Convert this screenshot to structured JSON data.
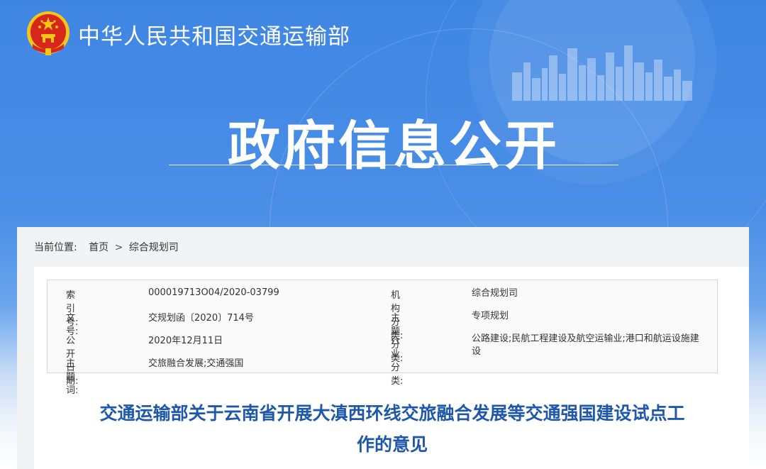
{
  "header": {
    "ministry_name": "中华人民共和国交通运输部",
    "banner_title": "政府信息公开",
    "emblem_icon": "national-emblem-icon"
  },
  "breadcrumb": {
    "label": "当前位置:",
    "home": "首页",
    "separator": ">",
    "current": "综合规划司"
  },
  "metadata": {
    "left": [
      {
        "label": "索引号:",
        "value": "000019713O04/2020-03799"
      },
      {
        "label": "文号:",
        "value": "交规划函〔2020〕714号"
      },
      {
        "label": "公开日期:",
        "value": "2020年12月11日"
      },
      {
        "label": "主题词:",
        "value": "交旅融合发展;交通强国"
      }
    ],
    "right": [
      {
        "label": "机构分类:",
        "value": "综合规划司"
      },
      {
        "label": "主题分类:",
        "value": "专项规划"
      },
      {
        "label": "行业分类:",
        "value": "公路建设;民航工程建设及航空运输业;港口和航运设施建设"
      }
    ]
  },
  "article": {
    "title_line1": "交通运输部关于云南省开展大滇西环线交旅融合发展等交通强国建设试点工",
    "title_line2": "作的意见"
  },
  "colors": {
    "banner_blue": "#3f86e3",
    "title_blue": "#1f58a8",
    "emblem_red": "#d7261c",
    "emblem_gold": "#f5c518"
  }
}
